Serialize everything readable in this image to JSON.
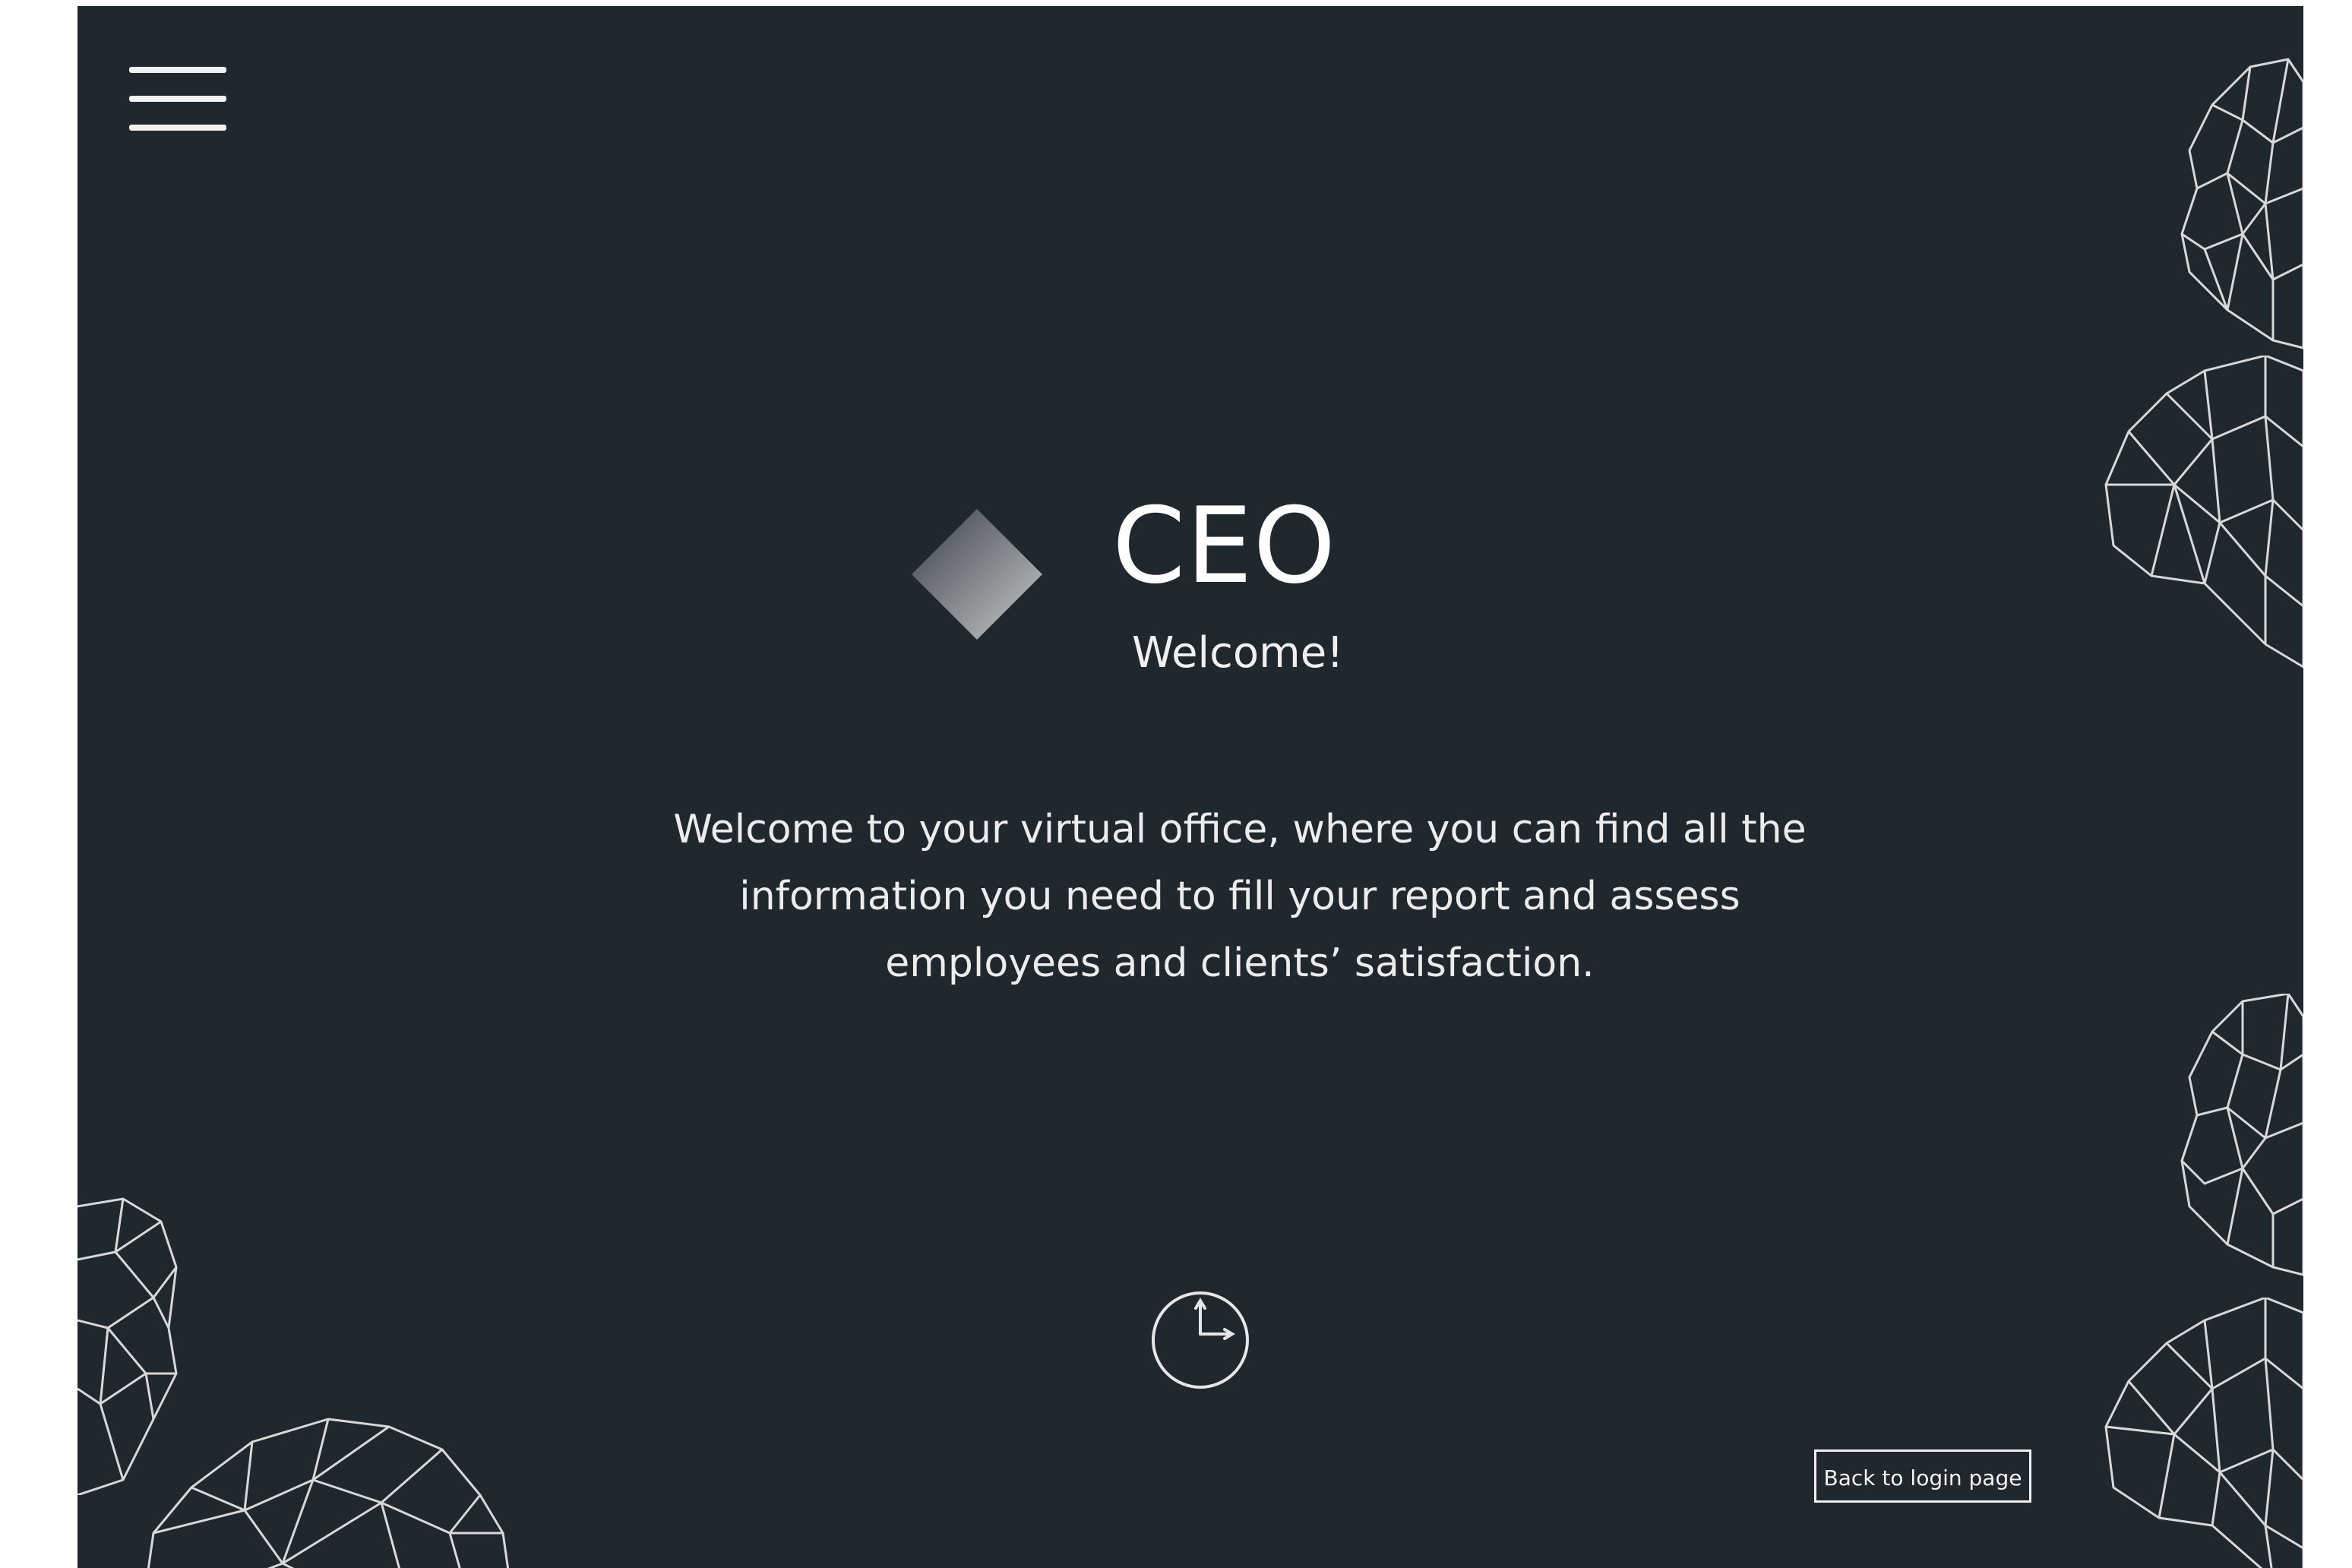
{
  "header": {
    "menu_icon": "hamburger-menu-icon"
  },
  "hero": {
    "logo_icon": "diamond-logo-icon",
    "title": "CEO",
    "subtitle": "Welcome!",
    "intro_line1": "Welcome to your virtual office, where you can find all the",
    "intro_line2": "information you need to fill your report and assess",
    "intro_line3": "employees and clients’ satisfaction."
  },
  "footer": {
    "clock_icon": "clock-icon",
    "back_button_label": "Back to login page"
  },
  "colors": {
    "background": "#20272d",
    "foreground": "#ffffff",
    "decor_stroke": "#d8d8d8"
  }
}
